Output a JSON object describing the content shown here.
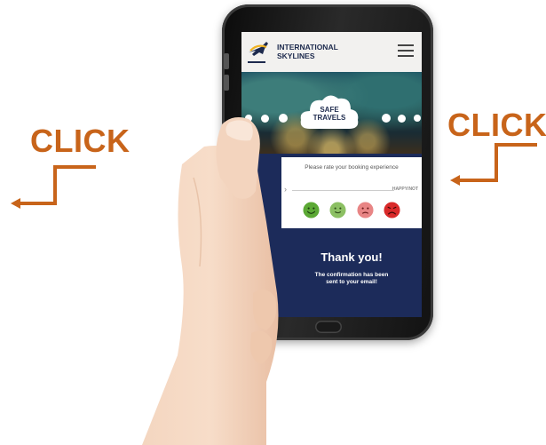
{
  "annotations": {
    "left_label": "CLICK",
    "right_label": "CLICK",
    "label_color": "#c8641a"
  },
  "app": {
    "brand_name": "INTERNATIONAL\nSKYLINES",
    "menu_icon": "hamburger-menu-icon",
    "hero_text": "SAFE\nTRAVELS",
    "rating_prompt": "Please rate your booking experience",
    "rating_scale_label": "HAPPY/NOT",
    "smileys": [
      {
        "mood": "very-happy",
        "color": "#5ca935"
      },
      {
        "mood": "happy",
        "color": "#8cc063"
      },
      {
        "mood": "unhappy",
        "color": "#e88585"
      },
      {
        "mood": "very-unhappy",
        "color": "#d92a2a"
      }
    ],
    "thanks_title": "Thank you!",
    "thanks_message": "The confirmation has been\nsent to your email!",
    "screen_bg": "#1c2b5a"
  }
}
